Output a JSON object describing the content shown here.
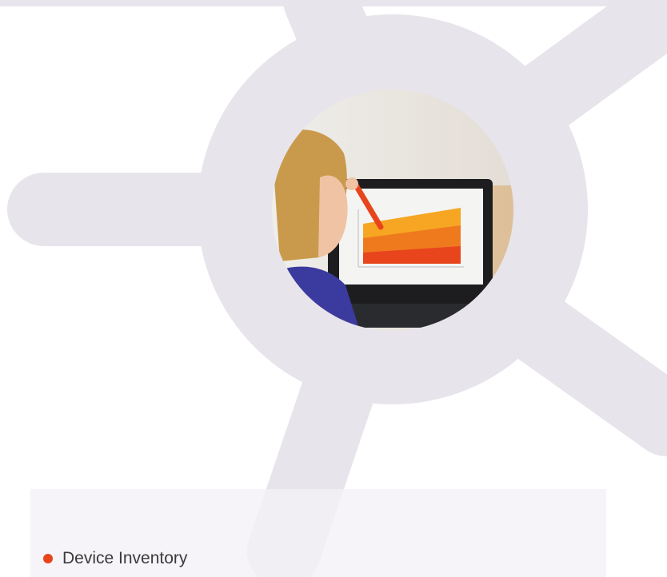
{
  "colors": {
    "brand_shape": "#e7e4eb",
    "panel_bg": "#f3f1f6",
    "bullet": "#e8451d",
    "text": "#3a3a3a"
  },
  "hero": {
    "image_subject": "person-pointing-at-laptop-chart",
    "chart_on_screen": {
      "type": "area",
      "colors": [
        "#f6a623",
        "#ef7a1e",
        "#e8451d"
      ]
    }
  },
  "features": {
    "items": [
      {
        "icon": "bullet-dot-icon",
        "label": "Device Inventory"
      }
    ]
  }
}
